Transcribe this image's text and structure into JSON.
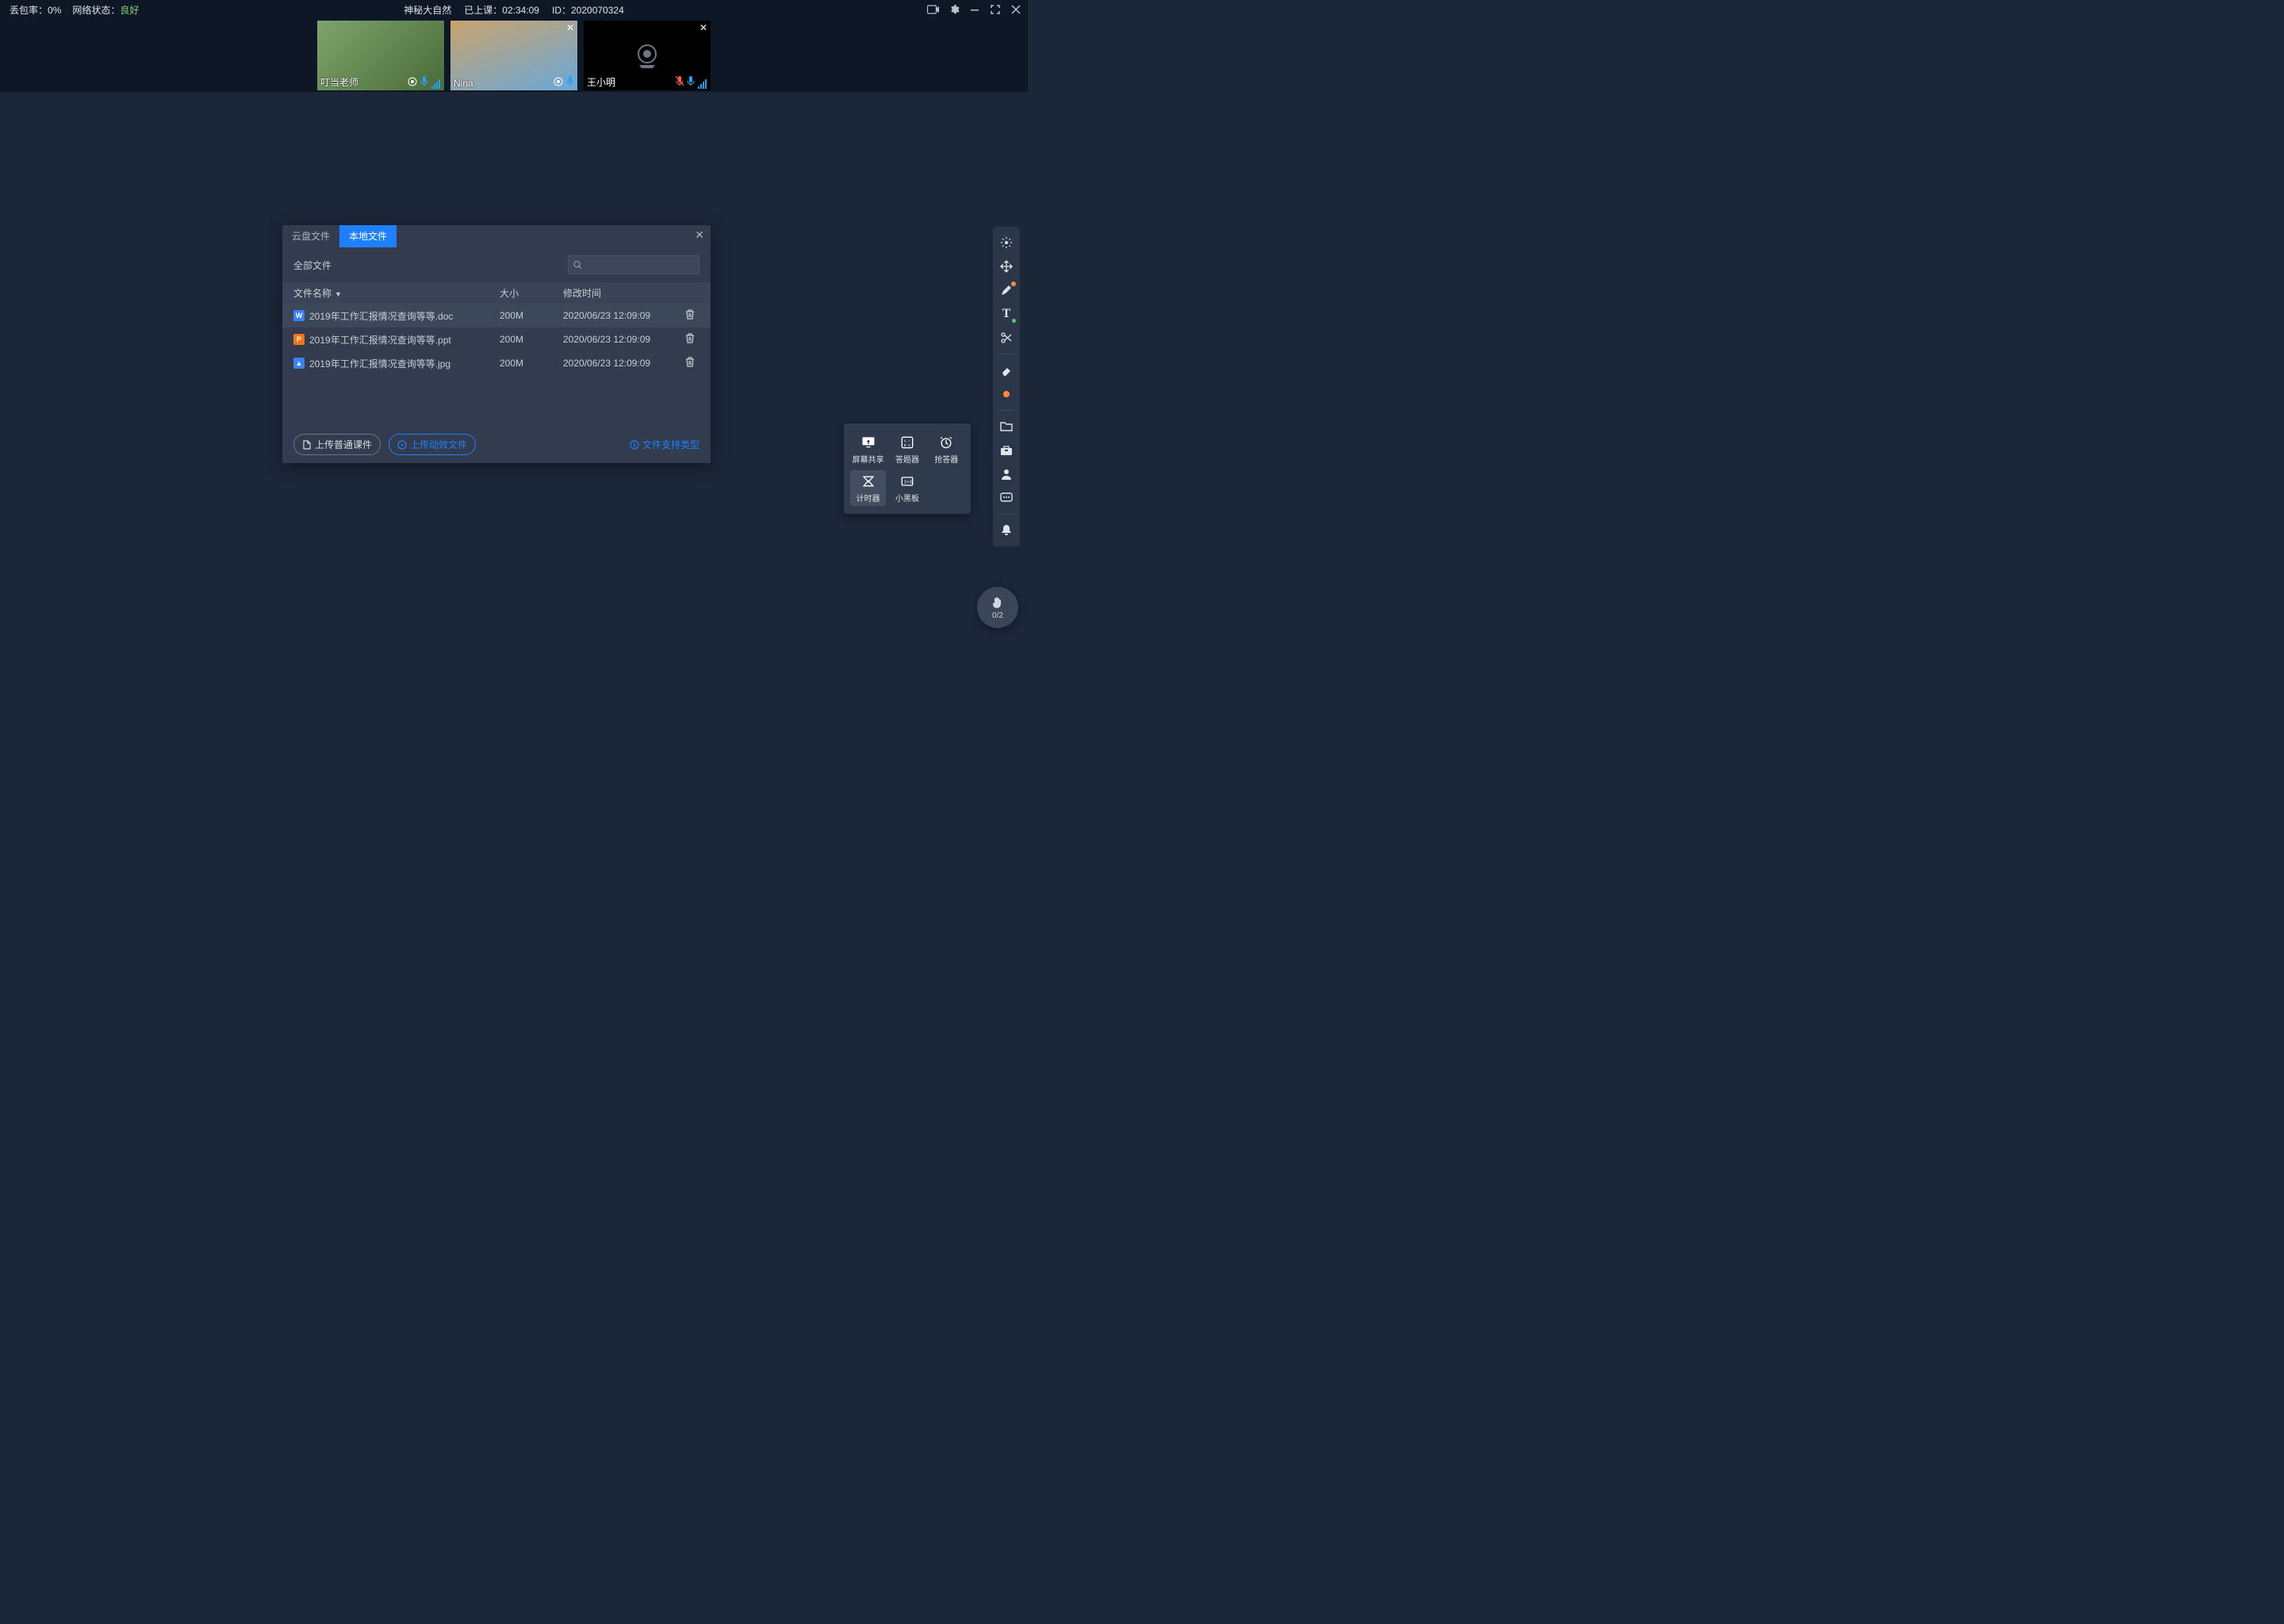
{
  "status": {
    "packet_loss_label": "丢包率：",
    "packet_loss_value": "0%",
    "network_label": "网络状态：",
    "network_value": "良好",
    "course_name": "神秘大自然",
    "elapsed_label": "已上课：",
    "elapsed_value": "02:34:09",
    "id_label": "ID：",
    "id_value": "2020070324"
  },
  "participants": [
    {
      "name": "叮当老师",
      "mic": "on",
      "has_close": false
    },
    {
      "name": "Nina",
      "mic": "on",
      "has_close": true
    },
    {
      "name": "王小明",
      "mic": "muted",
      "has_close": true
    }
  ],
  "dialog": {
    "tabs": {
      "cloud": "云盘文件",
      "local": "本地文件"
    },
    "filter_label": "全部文件",
    "search_placeholder": "",
    "columns": {
      "name": "文件名称",
      "size": "大小",
      "modified": "修改时间"
    },
    "files": [
      {
        "type": "doc",
        "badge": "W",
        "name": "2019年工作汇报情况查询等等.doc",
        "size": "200M",
        "modified": "2020/06/23 12:09:09"
      },
      {
        "type": "ppt",
        "badge": "P",
        "name": "2019年工作汇报情况查询等等.ppt",
        "size": "200M",
        "modified": "2020/06/23 12:09:09"
      },
      {
        "type": "jpg",
        "badge": "▲",
        "name": "2019年工作汇报情况查询等等.jpg",
        "size": "200M",
        "modified": "2020/06/23 12:09:09"
      }
    ],
    "upload_normal": "上传普通课件",
    "upload_dynamic": "上传动效文件",
    "support_link": "文件支持类型"
  },
  "toolbox": {
    "items": [
      {
        "key": "screen",
        "label": "屏幕共享"
      },
      {
        "key": "answer",
        "label": "答题器"
      },
      {
        "key": "buzzer",
        "label": "抢答器"
      },
      {
        "key": "timer",
        "label": "计时器",
        "active": true
      },
      {
        "key": "board",
        "label": "小黑板"
      }
    ]
  },
  "sidebar": {
    "tools": [
      "laser",
      "move",
      "pen",
      "text",
      "scissors",
      "eraser",
      "dot"
    ],
    "extras": [
      "folder",
      "toolbox",
      "user",
      "chat",
      "separator",
      "bell"
    ]
  },
  "hand": {
    "count": "0/2"
  }
}
